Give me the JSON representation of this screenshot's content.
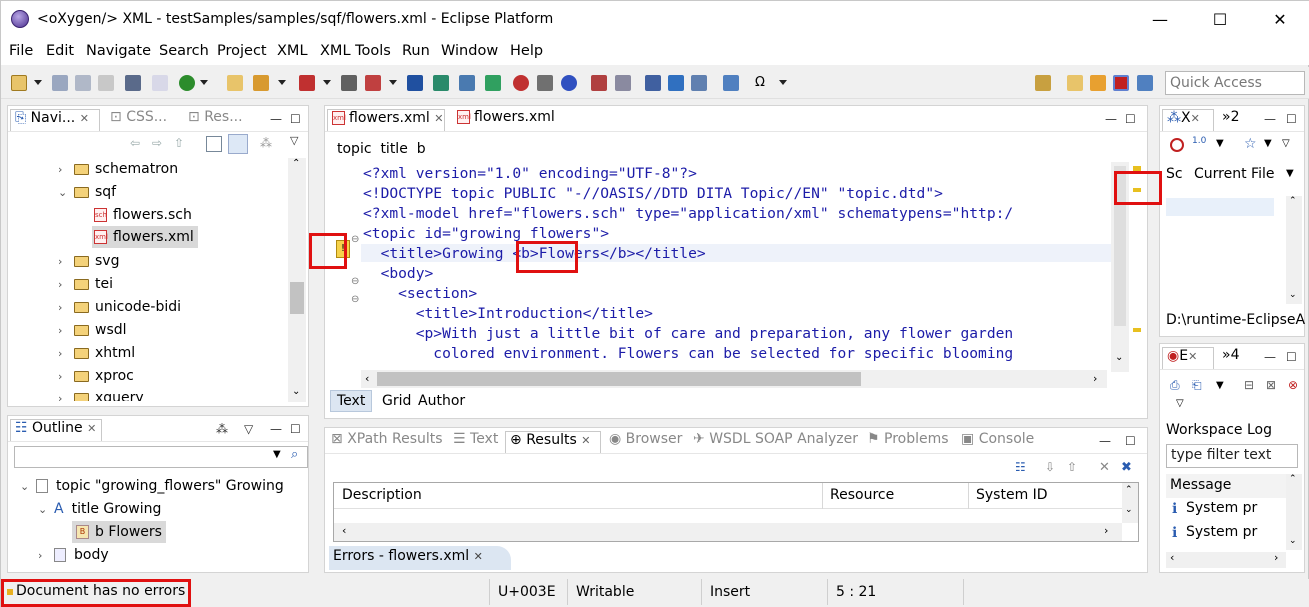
{
  "window": {
    "title": "<oXygen/> XML - testSamples/samples/sqf/flowers.xml - Eclipse Platform",
    "minimize": "—",
    "maximize": "☐",
    "close": "✕"
  },
  "menu": [
    "File",
    "Edit",
    "Navigate",
    "Search",
    "Project",
    "XML",
    "XML Tools",
    "Run",
    "Window",
    "Help"
  ],
  "quick_access": {
    "placeholder": "Quick Access"
  },
  "navigator": {
    "tabs": [
      "Navi...",
      "CSS...",
      "Res..."
    ],
    "items": [
      {
        "label": "schematron",
        "type": "folder",
        "expanded": false
      },
      {
        "label": "sqf",
        "type": "folder",
        "expanded": true
      },
      {
        "label": "flowers.sch",
        "type": "file"
      },
      {
        "label": "flowers.xml",
        "type": "file",
        "selected": true
      },
      {
        "label": "svg",
        "type": "folder",
        "expanded": false
      },
      {
        "label": "tei",
        "type": "folder",
        "expanded": false
      },
      {
        "label": "unicode-bidi",
        "type": "folder",
        "expanded": false
      },
      {
        "label": "wsdl",
        "type": "folder",
        "expanded": false
      },
      {
        "label": "xhtml",
        "type": "folder",
        "expanded": false
      },
      {
        "label": "xproc",
        "type": "folder",
        "expanded": false
      },
      {
        "label": "xquery",
        "type": "folder",
        "expanded": false
      }
    ]
  },
  "outline": {
    "tab": "Outline",
    "rows": [
      {
        "label": "topic  \"growing_flowers\" Growing"
      },
      {
        "label": "title  Growing"
      },
      {
        "label": "b  Flowers"
      },
      {
        "label": "body"
      }
    ]
  },
  "editor": {
    "tabs": [
      "flowers.xml",
      "flowers.xml"
    ],
    "breadcrumb": [
      "topic",
      "title",
      "b"
    ],
    "lines": [
      "<?xml version=\"1.0\" encoding=\"UTF-8\"?>",
      "<!DOCTYPE topic PUBLIC \"-//OASIS//DTD DITA Topic//EN\" \"topic.dtd\">",
      "<?xml-model href=\"flowers.sch\" type=\"application/xml\" schematypens=\"http:/",
      "<topic id=\"growing_flowers\">",
      "  <title>Growing <b>Flowers</b></title>",
      "  <body>",
      "    <section>",
      "      <title>Introduction</title>",
      "      <p>With just a little bit of care and preparation, any flower garden",
      "        colored environment. Flowers can be selected for specific blooming"
    ],
    "mode_tabs": [
      "Text",
      "Grid",
      "Author"
    ]
  },
  "results_panel": {
    "tabs": [
      "XPath Results",
      "Text",
      "Results",
      "Browser",
      "WSDL SOAP Analyzer",
      "Problems",
      "Console"
    ],
    "columns": [
      "Description",
      "Resource",
      "System ID"
    ],
    "errors_tab": "Errors - flowers.xml"
  },
  "xpath_panel": {
    "tab": "X",
    "tab2": "»2",
    "scope_label": "Sc",
    "scope_value": "Current File",
    "path": "D:\\runtime-EclipseA"
  },
  "log_panel": {
    "tab": "E",
    "tab2": "»4",
    "title": "Workspace Log",
    "filter_placeholder": "type filter text",
    "message_header": "Message",
    "rows": [
      "System pr",
      "System pr"
    ]
  },
  "statusbar": {
    "message": "Document has no errors",
    "char": "U+003E",
    "writable": "Writable",
    "mode": "Insert",
    "position": "5 : 21"
  }
}
